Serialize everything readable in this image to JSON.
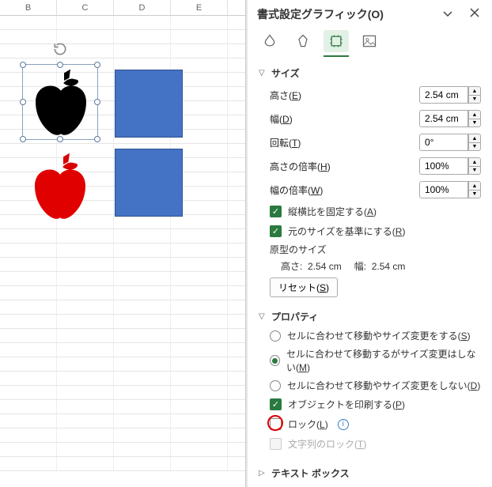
{
  "columns": [
    "B",
    "C",
    "D",
    "E"
  ],
  "panel": {
    "title": "書式設定グラフィック(O)"
  },
  "size": {
    "section": "サイズ",
    "height_lbl": "高さ",
    "height_key": "E",
    "height_val": "2.54 cm",
    "width_lbl": "幅",
    "width_key": "D",
    "width_val": "2.54 cm",
    "rotation_lbl": "回転",
    "rotation_key": "T",
    "rotation_val": "0°",
    "scale_h_lbl": "高さの倍率",
    "scale_h_key": "H",
    "scale_h_val": "100%",
    "scale_w_lbl": "幅の倍率",
    "scale_w_key": "W",
    "scale_w_val": "100%",
    "lock_aspect_lbl": "縦横比を固定する",
    "lock_aspect_key": "A",
    "rel_orig_lbl": "元のサイズを基準にする",
    "rel_orig_key": "R",
    "orig_title": "原型のサイズ",
    "orig_h_lbl": "高さ:",
    "orig_h_val": "2.54 cm",
    "orig_w_lbl": "幅:",
    "orig_w_val": "2.54 cm",
    "reset_lbl": "リセット",
    "reset_key": "S"
  },
  "prop": {
    "section": "プロパティ",
    "r1_lbl": "セルに合わせて移動やサイズ変更をする",
    "r1_key": "S",
    "r2_lbl": "セルに合わせて移動するがサイズ変更はしない",
    "r2_key": "M",
    "r3_lbl": "セルに合わせて移動やサイズ変更をしない",
    "r3_key": "D",
    "print_lbl": "オブジェクトを印刷する",
    "print_key": "P",
    "lock_lbl": "ロック",
    "lock_key": "L",
    "locktext_lbl": "文字列のロック",
    "locktext_key": "T"
  },
  "textbox": {
    "section": "テキスト ボックス"
  }
}
